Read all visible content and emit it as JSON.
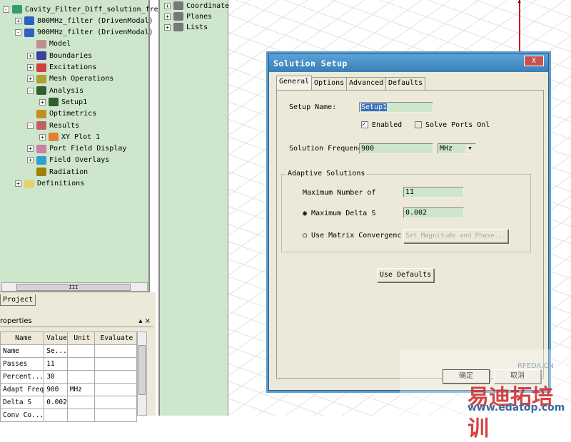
{
  "project_tree": {
    "items": [
      {
        "label": "Cavity_Filter_Diff_solution_freq",
        "expander": "-",
        "icon": "project-icon",
        "color": "#3a9a6a",
        "level": 0
      },
      {
        "label": "800MHz_filter (DrivenModal)",
        "expander": "+",
        "icon": "design-icon",
        "color": "#3060c0",
        "level": 1
      },
      {
        "label": "900MHz_filter (DrivenModal)",
        "expander": "-",
        "icon": "design-icon",
        "color": "#3060c0",
        "level": 1
      },
      {
        "label": "Model",
        "expander": "",
        "icon": "model-icon",
        "color": "#c09090",
        "level": 2
      },
      {
        "label": "Boundaries",
        "expander": "+",
        "icon": "boundaries-icon",
        "color": "#4040a0",
        "level": 2
      },
      {
        "label": "Excitations",
        "expander": "+",
        "icon": "excitations-icon",
        "color": "#d04040",
        "level": 2
      },
      {
        "label": "Mesh Operations",
        "expander": "+",
        "icon": "mesh-icon",
        "color": "#b0a030",
        "level": 2
      },
      {
        "label": "Analysis",
        "expander": "-",
        "icon": "analysis-icon",
        "color": "#306030",
        "level": 2
      },
      {
        "label": "Setup1",
        "expander": "+",
        "icon": "setup-icon",
        "color": "#306030",
        "level": 3
      },
      {
        "label": "Optimetrics",
        "expander": "",
        "icon": "optimetrics-icon",
        "color": "#c09020",
        "level": 2
      },
      {
        "label": "Results",
        "expander": "-",
        "icon": "results-icon",
        "color": "#c06060",
        "level": 2
      },
      {
        "label": "XY Plot 1",
        "expander": "+",
        "icon": "xy-plot-icon",
        "color": "#e08030",
        "level": 3
      },
      {
        "label": "Port Field Display",
        "expander": "+",
        "icon": "port-field-icon",
        "color": "#d080a0",
        "level": 2
      },
      {
        "label": "Field Overlays",
        "expander": "+",
        "icon": "field-overlays-icon",
        "color": "#30a0d0",
        "level": 2
      },
      {
        "label": "Radiation",
        "expander": "",
        "icon": "radiation-icon",
        "color": "#a08000",
        "level": 2
      },
      {
        "label": "Definitions",
        "expander": "+",
        "icon": "folder-icon",
        "color": "#e8d070",
        "level": 1
      }
    ],
    "scroll_grip": "III"
  },
  "project_tab": "Project",
  "properties": {
    "title": "roperties",
    "controls": "▴ ×",
    "columns": [
      "Name",
      "Value",
      "Unit",
      "Evaluate"
    ],
    "rows": [
      [
        "Name",
        "Se...",
        "",
        ""
      ],
      [
        "Passes",
        "11",
        "",
        ""
      ],
      [
        "Percent...",
        "30",
        "",
        ""
      ],
      [
        "Adapt Freq",
        "900",
        "MHz",
        ""
      ],
      [
        "Delta S",
        "0.002",
        "",
        ""
      ],
      [
        "Conv Co...",
        "",
        "",
        ""
      ]
    ]
  },
  "modeler_tree": {
    "items": [
      {
        "label": "Coordinate",
        "icon": "coordinate-icon"
      },
      {
        "label": "Planes",
        "icon": "planes-icon"
      },
      {
        "label": "Lists",
        "icon": "lists-icon"
      }
    ]
  },
  "viewport": {
    "axis_label": "Z"
  },
  "dialog": {
    "title": "Solution Setup",
    "close": "X",
    "tabs": [
      "General",
      "Options",
      "Advanced",
      "Defaults"
    ],
    "setup_name_label": "Setup Name:",
    "setup_name": "Setup1",
    "enabled_label": "Enabled",
    "enabled": true,
    "solve_ports_label": "Solve Ports Onl",
    "solve_ports": false,
    "freq_label": "Solution Frequency",
    "freq_value": "900",
    "freq_unit": "MHz",
    "group_title": "Adaptive Solutions",
    "max_passes_label": "Maximum Number of",
    "max_passes": "11",
    "max_delta_label": "Maximum Delta S",
    "max_delta": "0.002",
    "matrix_label": "Use Matrix Convergence",
    "set_mag_button": "Set Magnitude and Phase...",
    "use_defaults": "Use Defaults",
    "ok": "确定",
    "cancel": "取消"
  },
  "watermark": {
    "cn": "易迪拓培训",
    "url": "www.edatop.com",
    "site": "RFEDA.CN"
  }
}
